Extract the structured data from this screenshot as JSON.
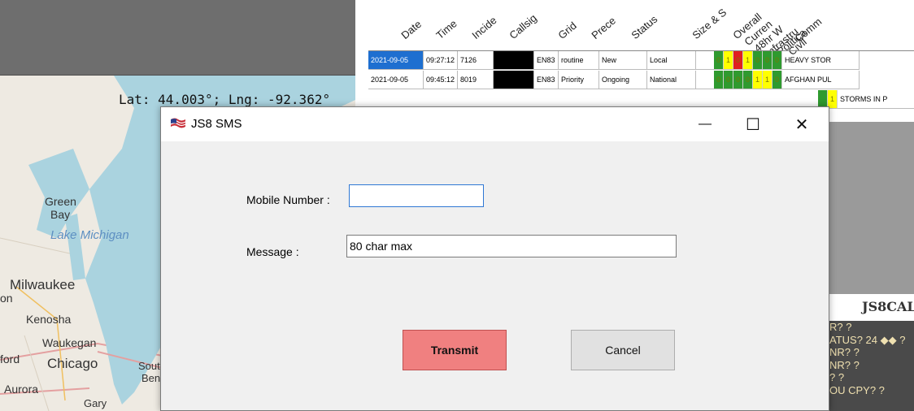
{
  "map": {
    "coordinates": "Lat: 44.003°; Lng: -92.362°",
    "lake": "Lake Michigan",
    "cities": [
      "Green",
      "Bay",
      "Milwaukee",
      "Kenosha",
      "Waukegan",
      "Chicago",
      "Aurora",
      "Gary",
      "ford",
      "on",
      "Sout",
      "Ben"
    ],
    "colors": {
      "water": "#aad3df",
      "land": "#eeeae2",
      "road": "#e4a0a0"
    }
  },
  "table": {
    "headers": [
      "Date",
      "Time",
      "Incide",
      "Callsig",
      "Grid",
      "Prece",
      "Status",
      "Size & S",
      "Overall",
      "Curren",
      "48hr W",
      "Infrastru",
      "Politica",
      "Civil",
      "Comm"
    ],
    "rows": [
      {
        "date": "2021-09-05",
        "time": "09:27:12",
        "incident": "7126",
        "grid": "EN83",
        "precedence": "routine",
        "status": "New",
        "size": "Local",
        "squares": [
          "0",
          "1",
          "0",
          "1",
          "0",
          "0",
          "0"
        ],
        "square_colors": [
          "#2f9a2f",
          "#ffff00",
          "#e02020",
          "#ffff00",
          "#2f9a2f",
          "#2f9a2f",
          "#2f9a2f"
        ],
        "comment": "HEAVY STOR"
      },
      {
        "date": "2021-09-05",
        "time": "09:45:12",
        "incident": "8019",
        "grid": "EN83",
        "precedence": "Priority",
        "status": "Ongoing",
        "size": "National",
        "squares": [
          "0",
          "0",
          "0",
          "0",
          "1",
          "1",
          "0"
        ],
        "square_colors": [
          "#2f9a2f",
          "#2f9a2f",
          "#2f9a2f",
          "#2f9a2f",
          "#ffff00",
          "#ffff00",
          "#2f9a2f"
        ],
        "comment": "AFGHAN PUL"
      },
      {
        "comment": "STORMS IN P",
        "squares": [
          "1"
        ],
        "square_colors": [
          "#ffff00"
        ]
      }
    ],
    "log_title": "JS8CAL",
    "log_lines": [
      "R? ?",
      "ATUS? 24 ◆◆ ?",
      "NR? ?",
      "NR? ?",
      "? ?",
      "OU CPY? ?"
    ]
  },
  "dialog": {
    "title": "JS8 SMS",
    "minimize": "—",
    "maximize": "☐",
    "close": "✕",
    "mobile_label": "Mobile Number :",
    "mobile_value": "",
    "message_label": "Message :",
    "message_value": "80 char max",
    "transmit_label": "Transmit",
    "cancel_label": "Cancel",
    "accent": "#f08080"
  }
}
